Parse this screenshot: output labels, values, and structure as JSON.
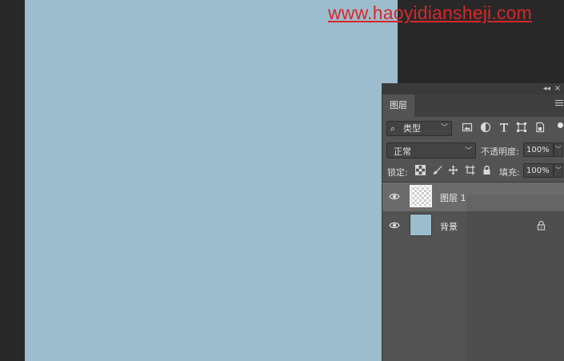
{
  "watermark": {
    "text": "www.haoyidiansheji.com"
  },
  "colors": {
    "canvas": "#9bbdcd",
    "workspace": "#282828",
    "panel": "#535353",
    "selected_row": "#6b6b6b",
    "watermark": "#d9262a"
  },
  "panel": {
    "collapse_label": "◂◂",
    "close_label": "×",
    "tab": "图层"
  },
  "filter": {
    "kind_label": "类型",
    "icons": [
      "image-filter-icon",
      "adjustment-filter-icon",
      "type-filter-icon",
      "shape-filter-icon",
      "smart-object-filter-icon"
    ]
  },
  "blend": {
    "mode": "正常",
    "opacity_label": "不透明度:",
    "opacity_value": "100%"
  },
  "lock": {
    "label": "锁定:",
    "icons": [
      "lock-transparent-icon",
      "lock-image-icon",
      "lock-position-icon",
      "lock-artboard-icon",
      "lock-all-icon"
    ],
    "fill_label": "填充:",
    "fill_value": "100%"
  },
  "layers": [
    {
      "name": "图层 1",
      "selected": true,
      "visible": true,
      "thumbnail": "transparent"
    },
    {
      "name": "背景",
      "selected": false,
      "visible": true,
      "thumbnail": "canvas-color",
      "locked": true
    }
  ]
}
